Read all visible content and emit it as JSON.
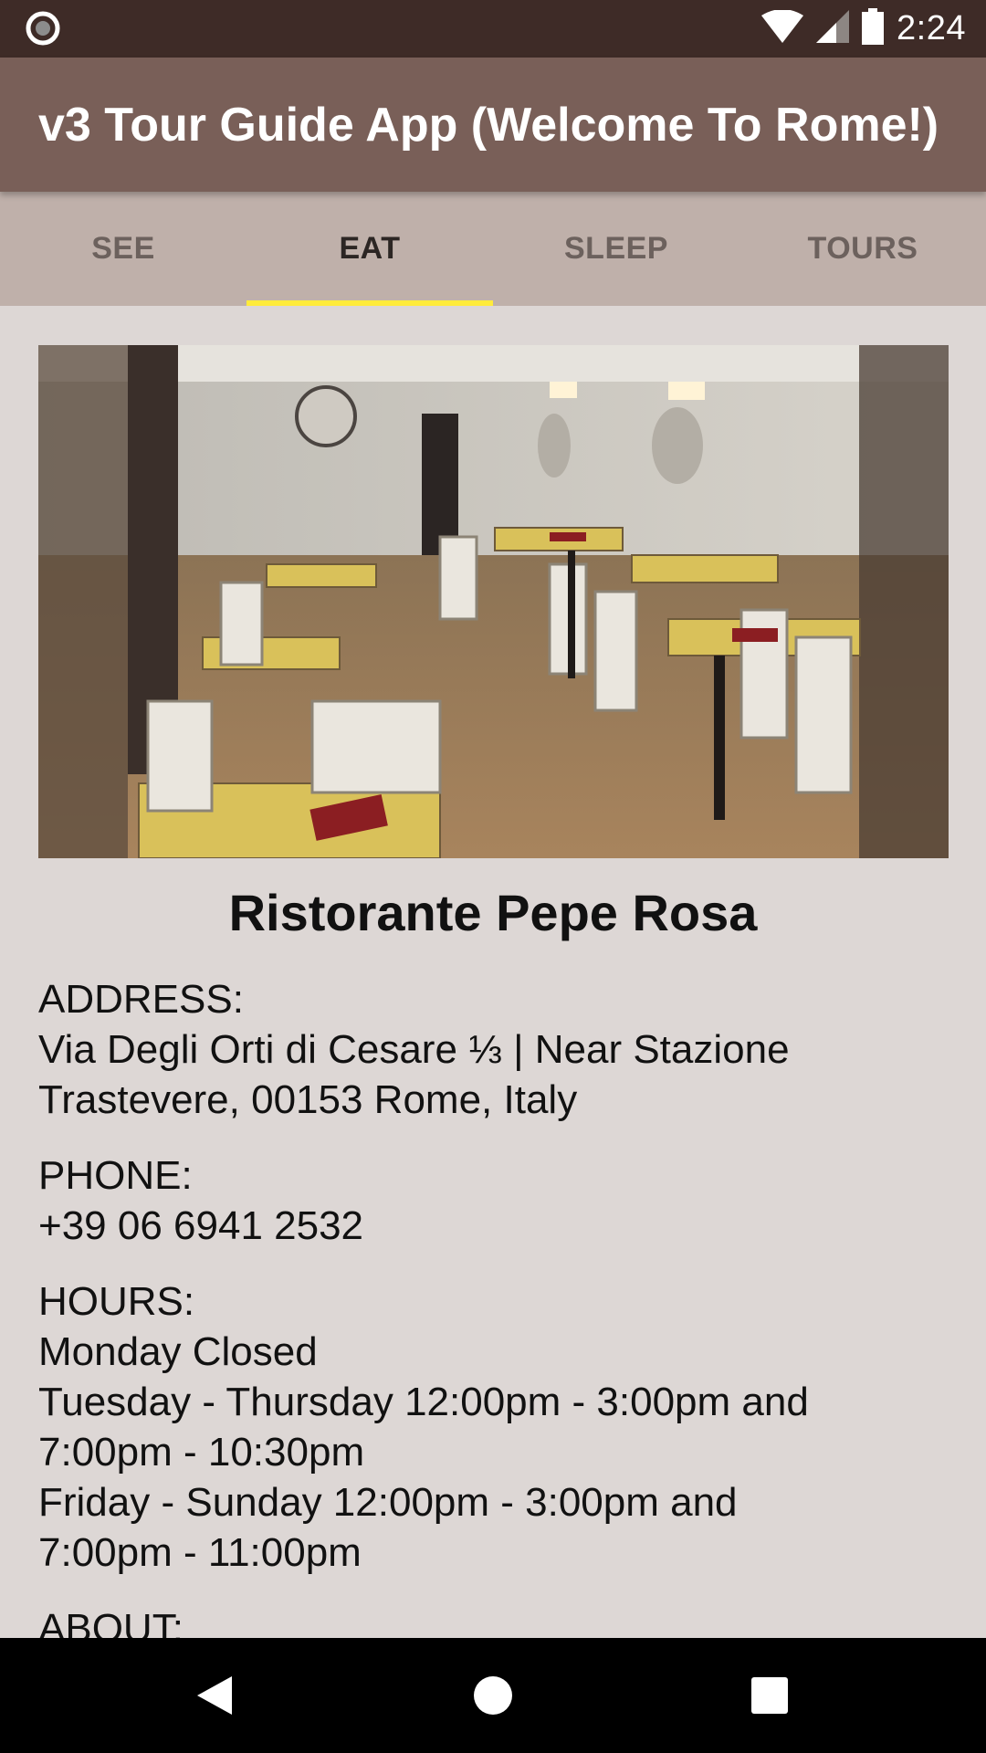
{
  "status_bar": {
    "time": "2:24",
    "icons": [
      "notification-dot-icon",
      "wifi-icon",
      "cellular-signal-icon",
      "battery-icon"
    ]
  },
  "app_bar": {
    "title": "v3 Tour Guide App (Welcome To Rome!)"
  },
  "tabs": [
    {
      "label": "SEE",
      "active": false
    },
    {
      "label": "EAT",
      "active": true
    },
    {
      "label": "SLEEP",
      "active": false
    },
    {
      "label": "TOURS",
      "active": false
    }
  ],
  "place": {
    "name": "Ristorante Pepe Rosa",
    "address_label": "ADDRESS:",
    "address_lines": [
      "Via Degli Orti di Cesare ⅓ | Near Stazione",
      "Trastevere, 00153 Rome, Italy"
    ],
    "phone_label": "PHONE:",
    "phone": "+39 06 6941 2532",
    "hours_label": "HOURS:",
    "hours_lines": [
      "Monday Closed",
      "Tuesday - Thursday 12:00pm - 3:00pm and",
      "7:00pm - 10:30pm",
      "Friday - Sunday 12:00pm - 3:00pm and",
      "7:00pm - 11:00pm"
    ],
    "about_label": "ABOUT:"
  },
  "nav_bar": {
    "icons": [
      "back-icon",
      "home-icon",
      "recents-icon"
    ]
  },
  "colors": {
    "status_bar": "#3e2b27",
    "app_bar": "#795f58",
    "tab_bar": "#bfb0aa",
    "tab_indicator": "#ffeb3b",
    "content_bg": "#ddd7d5"
  }
}
